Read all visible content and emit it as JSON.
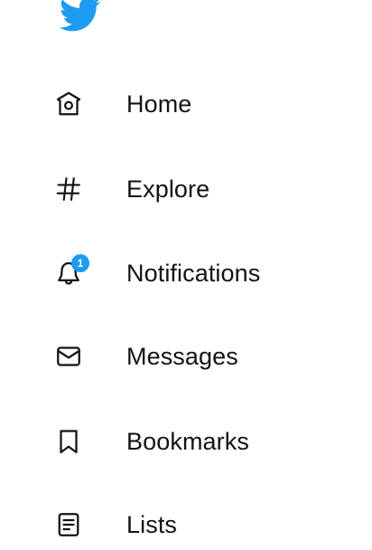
{
  "colors": {
    "brand": "#1d9bf0",
    "text": "#0f1419",
    "badge_bg": "#1d9bf0",
    "badge_text": "#ffffff"
  },
  "logo": {
    "icon": "twitter-bird-icon"
  },
  "nav": {
    "items": [
      {
        "id": "home",
        "label": "Home",
        "icon": "home-icon"
      },
      {
        "id": "explore",
        "label": "Explore",
        "icon": "hashtag-icon"
      },
      {
        "id": "notifications",
        "label": "Notifications",
        "icon": "bell-icon",
        "badge": "1"
      },
      {
        "id": "messages",
        "label": "Messages",
        "icon": "envelope-icon"
      },
      {
        "id": "bookmarks",
        "label": "Bookmarks",
        "icon": "bookmark-icon"
      },
      {
        "id": "lists",
        "label": "Lists",
        "icon": "list-icon"
      }
    ]
  }
}
